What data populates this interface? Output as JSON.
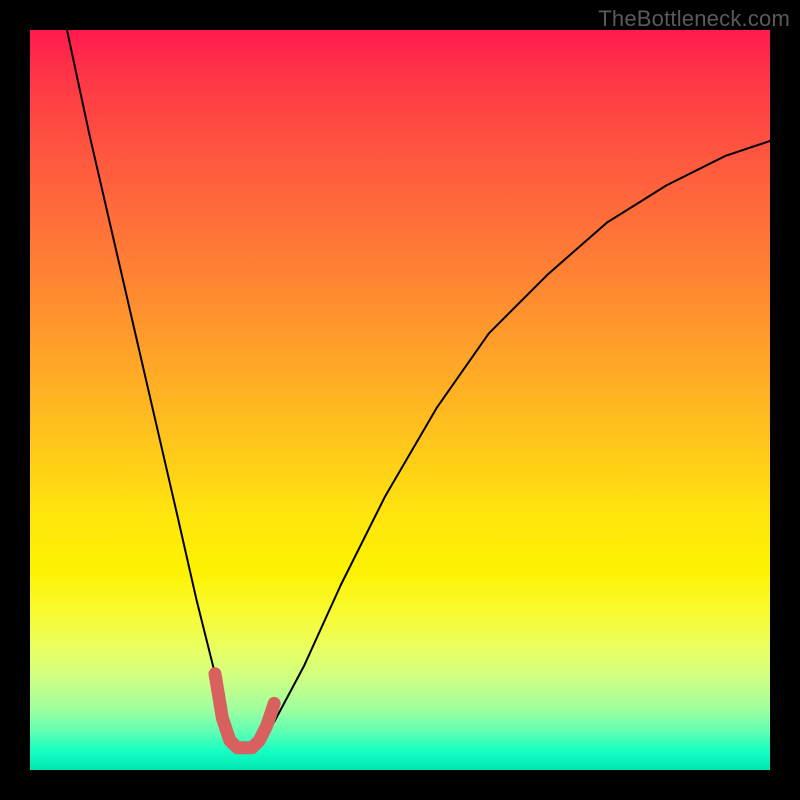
{
  "watermark": "TheBottleneck.com",
  "chart_data": {
    "type": "line",
    "title": "",
    "xlabel": "",
    "ylabel": "",
    "xlim": [
      0,
      100
    ],
    "ylim": [
      0,
      100
    ],
    "series": [
      {
        "name": "main-curve",
        "x": [
          5,
          8,
          11,
          14,
          17,
          20,
          22.5,
          25,
          26.5,
          28,
          30.5,
          33,
          37,
          42,
          48,
          55,
          62,
          70,
          78,
          86,
          94,
          100
        ],
        "y": [
          100,
          86,
          73,
          60,
          47,
          34,
          23,
          13,
          6.5,
          3,
          3,
          6.5,
          14,
          25,
          37,
          49,
          59,
          67,
          74,
          79,
          83,
          85
        ]
      },
      {
        "name": "bottom-highlight",
        "x": [
          25,
          26,
          27,
          28,
          29,
          30,
          31,
          32,
          33
        ],
        "y": [
          13,
          7,
          4,
          3,
          3,
          3,
          4,
          6,
          9
        ]
      }
    ],
    "gradient_stops": [
      {
        "offset": 0.0,
        "color": "#ff1a4d"
      },
      {
        "offset": 0.18,
        "color": "#ff5a3f"
      },
      {
        "offset": 0.43,
        "color": "#ffa02a"
      },
      {
        "offset": 0.66,
        "color": "#ffe60d"
      },
      {
        "offset": 0.84,
        "color": "#e8ff66"
      },
      {
        "offset": 0.95,
        "color": "#5affb4"
      },
      {
        "offset": 1.0,
        "color": "#00e6b3"
      }
    ]
  }
}
